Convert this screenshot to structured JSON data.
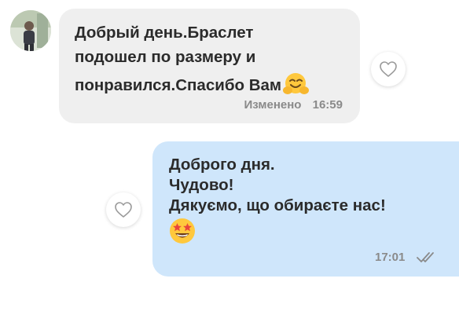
{
  "conversation": {
    "incoming": {
      "lines": [
        "Добрый день.Браслет",
        "подошел по размеру и",
        "понравился.Спасибо Вам"
      ],
      "emoji": "hugging-face",
      "edited_label": "Изменено",
      "time": "16:59"
    },
    "outgoing": {
      "lines": [
        "Доброго дня.",
        "Чудово!",
        "Дякуємо, що обираєте нас!"
      ],
      "emoji": "star-struck-face",
      "time": "17:01",
      "status_icon": "double-check-icon"
    }
  },
  "colors": {
    "incoming_bubble": "#efefef",
    "outgoing_bubble": "#cfe6fb",
    "meta_text": "#8a8a8a",
    "message_text": "#2b2b2b"
  },
  "icons": [
    "avatar",
    "heart-icon",
    "hugging-face-emoji",
    "star-struck-emoji",
    "double-check-icon"
  ]
}
